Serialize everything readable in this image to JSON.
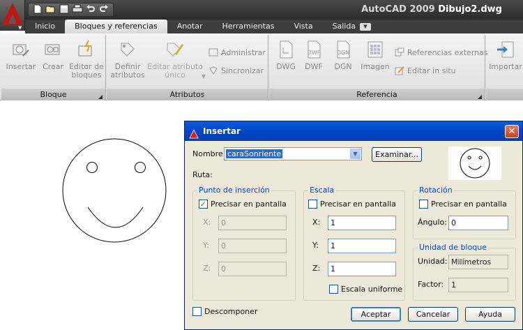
{
  "app": {
    "name": "AutoCAD 2009",
    "document": "Dibujo2.dwg"
  },
  "quick_access": {
    "icons": [
      "new-icon",
      "open-icon",
      "save-icon",
      "print-icon",
      "undo-icon",
      "redo-icon"
    ]
  },
  "tabs": [
    {
      "label": "Inicio",
      "active": false
    },
    {
      "label": "Bloques y referencias",
      "active": true
    },
    {
      "label": "Anotar",
      "active": false
    },
    {
      "label": "Herramientas",
      "active": false
    },
    {
      "label": "Vista",
      "active": false
    },
    {
      "label": "Salida",
      "active": false
    }
  ],
  "ribbon": {
    "bloque": {
      "title": "Bloque",
      "insertar": "Insertar",
      "crear": "Crear",
      "editor_line1": "Editor de",
      "editor_line2": "bloques"
    },
    "atributos": {
      "title": "Atributos",
      "definir_line1": "Definir",
      "definir_line2": "atributos",
      "editar_line1": "Editar atributo",
      "editar_line2": "único",
      "administrar": "Administrar",
      "sincronizar": "Sincronizar"
    },
    "referencia": {
      "title": "Referencia",
      "dwg": "DWG",
      "dwf": "DWF",
      "dgn": "DGN",
      "imagen": "Imagen",
      "dwf_badge": "DWF",
      "dgn_badge": "DGN",
      "referencias_externas": "Referencias externas",
      "editar_in_situ": "Editar in situ"
    },
    "importar": {
      "importar": "Importar"
    }
  },
  "dialog": {
    "title": "Insertar",
    "nombre_label": "Nombre:",
    "nombre_value": "caraSonriente",
    "examinar": "Examinar...",
    "ruta_label": "Ruta:",
    "punto": {
      "title": "Punto de inserción",
      "precisar": "Precisar en pantalla",
      "precisar_checked": true,
      "x_label": "X:",
      "x_value": "0",
      "y_label": "Y:",
      "y_value": "0",
      "z_label": "Z:",
      "z_value": "0"
    },
    "escala": {
      "title": "Escala",
      "precisar": "Precisar en pantalla",
      "precisar_checked": false,
      "x_label": "X:",
      "x_value": "1",
      "y_label": "Y:",
      "y_value": "1",
      "z_label": "Z:",
      "z_value": "1",
      "uniforme": "Escala uniforme",
      "uniforme_checked": false
    },
    "rotacion": {
      "title": "Rotación",
      "precisar": "Precisar en pantalla",
      "precisar_checked": false,
      "angulo_label": "Ángulo:",
      "angulo_value": "0"
    },
    "unidad": {
      "title": "Unidad de bloque",
      "unidad_label": "Unidad:",
      "unidad_value": "Milímetros",
      "factor_label": "Factor:",
      "factor_value": "1"
    },
    "descomponer": "Descomponer",
    "descomponer_checked": false,
    "aceptar": "Aceptar",
    "cancelar": "Cancelar",
    "ayuda": "Ayuda"
  }
}
